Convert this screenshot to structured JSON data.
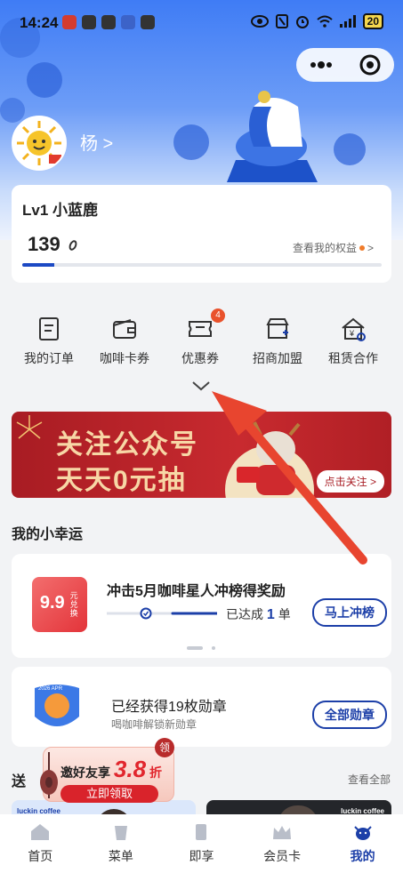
{
  "status_bar": {
    "time": "14:24",
    "battery": "20"
  },
  "user": {
    "name": "杨 >"
  },
  "level": {
    "title": "Lv1 小蓝鹿",
    "points": "139",
    "benefits_link": "查看我的权益",
    "progress": 0.09
  },
  "quick_actions": [
    {
      "label": "我的订单"
    },
    {
      "label": "咖啡卡券"
    },
    {
      "label": "优惠券",
      "badge": "4"
    },
    {
      "label": "招商加盟"
    },
    {
      "label": "租赁合作"
    }
  ],
  "banner": {
    "line1": "关注公众号",
    "line2": "天天0元抽",
    "button": "点击关注 >"
  },
  "lucky": {
    "section_title": "我的小幸运",
    "promo_title": "冲击5月咖啡星人冲榜得奖励",
    "progress_text": "已达成",
    "progress_count": "1",
    "progress_unit": "单",
    "button": "马上冲榜",
    "coupon_value": "9.9",
    "coupon_unit": "元兑换"
  },
  "medal": {
    "title": "已经获得19枚勋章",
    "subtitle": "喝咖啡解锁新勋章",
    "button": "全部勋章",
    "medal_label": "2026 APR"
  },
  "invite": {
    "title": "邀好友享",
    "discount": "3.8",
    "discount_unit": "折",
    "tag": "领",
    "button": "立即领取"
  },
  "gift": {
    "section_prefix": "送",
    "view_all": "查看全部",
    "brand": "luckin coffee"
  },
  "tabs": [
    {
      "label": "首页"
    },
    {
      "label": "菜单"
    },
    {
      "label": "即享"
    },
    {
      "label": "会员卡"
    },
    {
      "label": "我的",
      "active": true
    }
  ],
  "colors": {
    "primary": "#1c3fa8",
    "accent": "#e9522c",
    "banner": "#b01f25",
    "arrow": "#e8452f"
  }
}
